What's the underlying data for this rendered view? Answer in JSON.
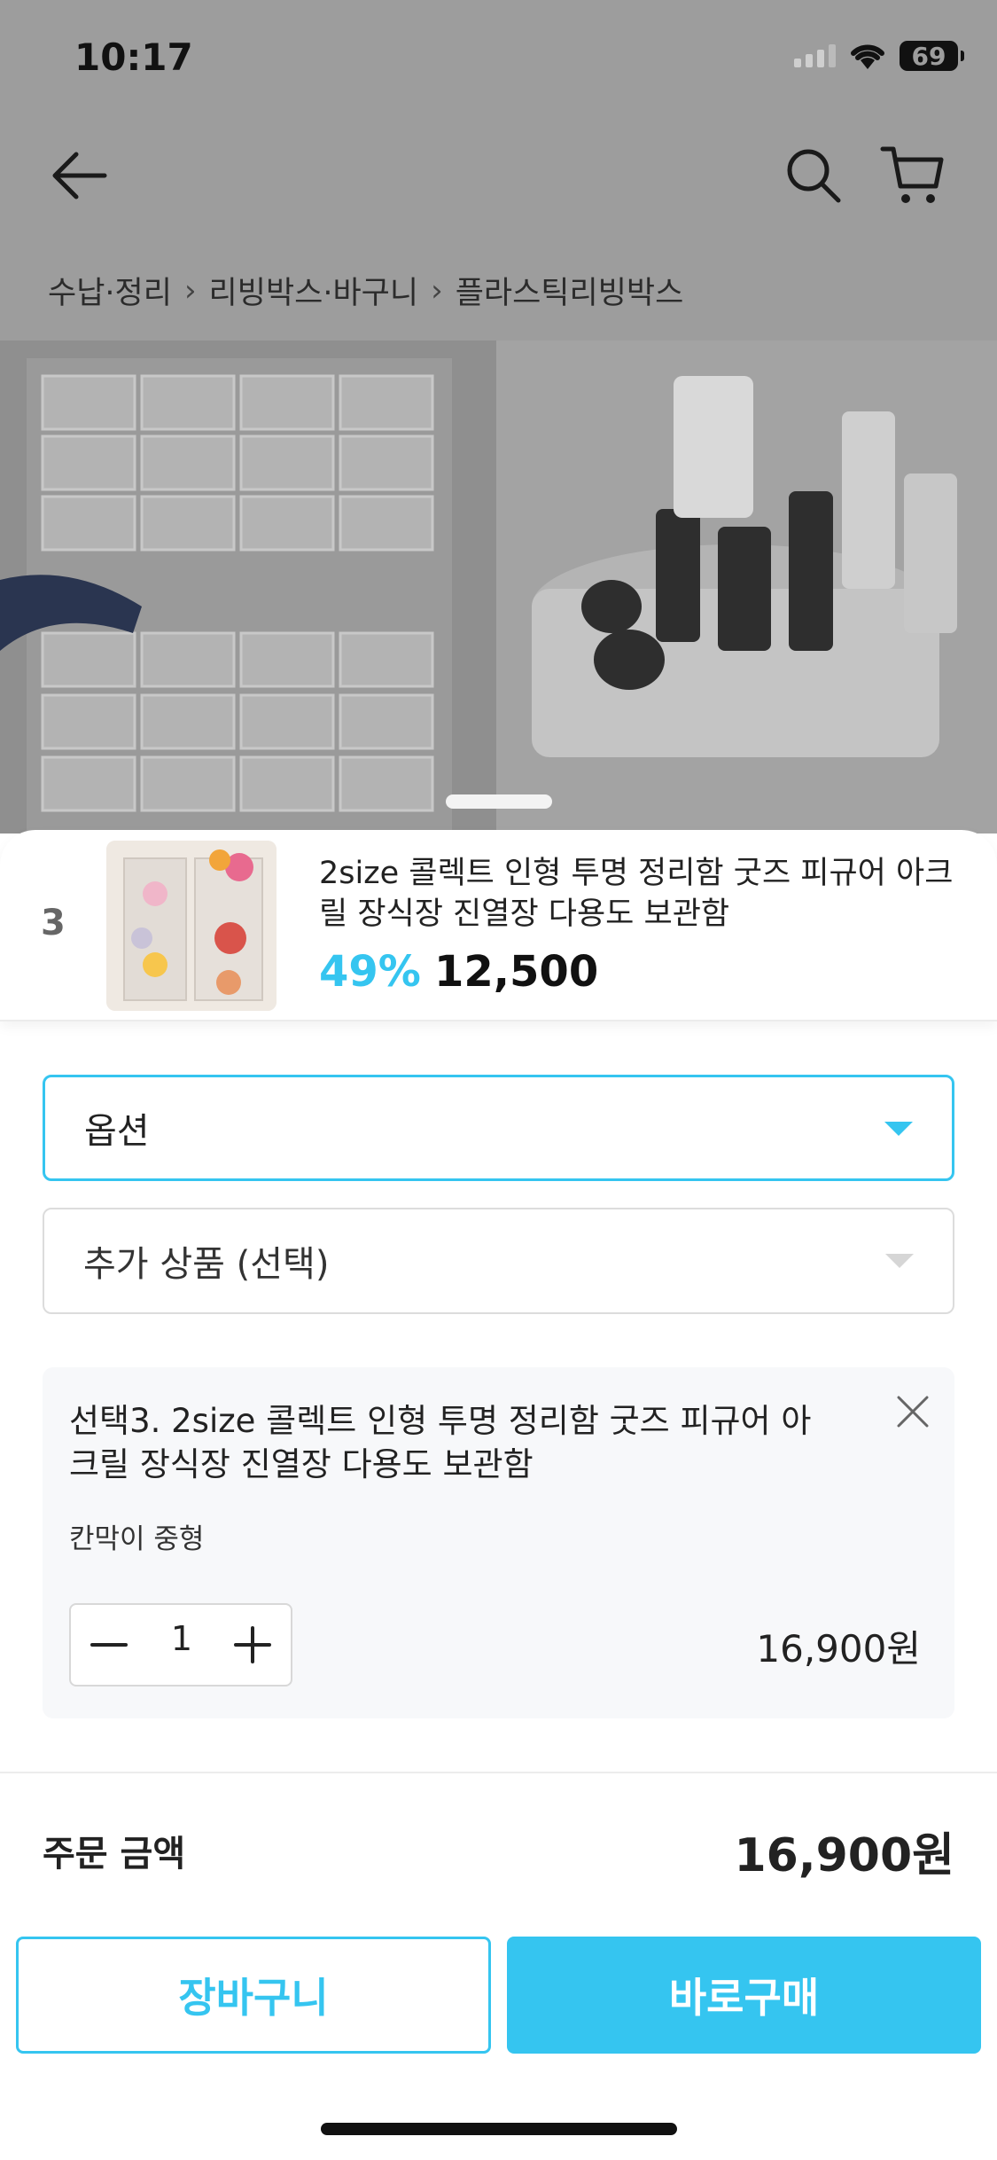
{
  "status_bar": {
    "time": "10:17",
    "battery": "69"
  },
  "nav": {
    "back_icon": "arrow-left-icon",
    "search_icon": "search-icon",
    "cart_icon": "cart-icon"
  },
  "breadcrumb": [
    "수납·정리",
    "리빙박스·바구니",
    "플라스틱리빙박스"
  ],
  "product": {
    "index": "3",
    "title": "2size 콜렉트 인형 투명 정리함 굿즈 피규어 아크릴 장식장 진열장 다용도 보관함",
    "discount": "49%",
    "price": "12,500"
  },
  "selects": {
    "option": "옵션",
    "extra": "추가 상품 (선택)"
  },
  "selected_option": {
    "title": "선택3. 2size 콜렉트 인형 투명 정리함 굿즈 피규어 아크릴 장식장 진열장 다용도 보관함",
    "variant": "칸막이 중형",
    "quantity": "1",
    "price": "16,900원"
  },
  "summary": {
    "label": "주문 금액",
    "total": "16,900원"
  },
  "actions": {
    "cart": "장바구니",
    "buy": "바로구매"
  },
  "colors": {
    "accent": "#35c5f0",
    "dim_overlay": "#9d9d9d"
  }
}
